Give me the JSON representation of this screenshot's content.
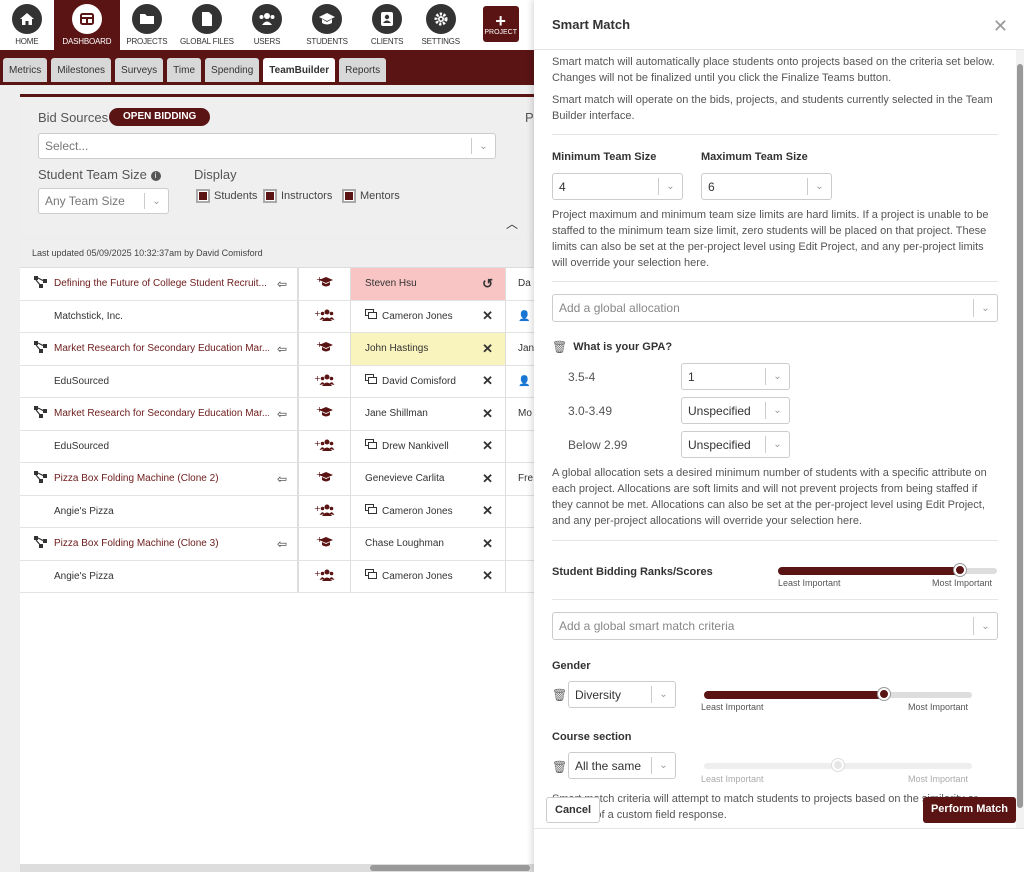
{
  "nav": [
    {
      "label": "HOME",
      "icon": "home-icon"
    },
    {
      "label": "DASHBOARD",
      "icon": "dashboard-icon",
      "active": true
    },
    {
      "label": "PROJECTS",
      "icon": "folder-icon"
    },
    {
      "label": "GLOBAL FILES",
      "icon": "file-icon"
    },
    {
      "label": "USERS",
      "icon": "users-icon"
    },
    {
      "label": "STUDENTS",
      "icon": "graduation-cap-icon"
    },
    {
      "label": "CLIENTS",
      "icon": "client-icon"
    },
    {
      "label": "SETTINGS",
      "icon": "gear-icon"
    },
    {
      "label": "PROJECT",
      "icon": "plus-icon"
    }
  ],
  "tabs": [
    "Metrics",
    "Milestones",
    "Surveys",
    "Time",
    "Spending",
    "TeamBuilder",
    "Reports"
  ],
  "active_tab": "TeamBuilder",
  "filters": {
    "bid_sources_label": "Bid Sources",
    "open_bidding": "OPEN BIDDING",
    "select_placeholder": "Select...",
    "team_size_label": "Student Team Size",
    "team_size_value": "Any Team Size",
    "display_label": "Display",
    "display_options": [
      "Students",
      "Instructors",
      "Mentors"
    ],
    "right_label": "P"
  },
  "table": {
    "updated": "Last updated 05/09/2025 10:32:37am by David Comisford",
    "rows": [
      {
        "type": "project",
        "text": "Defining the Future of College Student Recruit...",
        "student": "Steven Hsu",
        "student_action": "↺",
        "highlight": "pink",
        "extra": "Da"
      },
      {
        "type": "client",
        "text": "Matchstick, Inc.",
        "student": "Cameron Jones",
        "student_icon": true,
        "student_action": "✕",
        "extra": "👤"
      },
      {
        "type": "project",
        "text": "Market Research for Secondary Education Mar...",
        "student": "John Hastings",
        "student_action": "✕",
        "highlight": "yellow",
        "extra": "Jan"
      },
      {
        "type": "client",
        "text": "EduSourced",
        "student": "David Comisford",
        "student_icon": true,
        "student_action": "✕",
        "extra": "👤"
      },
      {
        "type": "project",
        "text": "Market Research for Secondary Education Mar...",
        "student": "Jane Shillman",
        "student_action": "✕",
        "extra": "Mo"
      },
      {
        "type": "client",
        "text": "EduSourced",
        "student": "Drew Nankivell",
        "student_icon": true,
        "student_action": "✕",
        "extra": ""
      },
      {
        "type": "project",
        "text": "Pizza Box Folding Machine (Clone 2)",
        "student": "Genevieve Carlita",
        "student_action": "✕",
        "extra": "Fre"
      },
      {
        "type": "client",
        "text": "Angie's Pizza",
        "student": "Cameron Jones",
        "student_icon": true,
        "student_action": "✕",
        "extra": ""
      },
      {
        "type": "project",
        "text": "Pizza Box Folding Machine (Clone 3)",
        "student": "Chase Loughman",
        "student_action": "✕",
        "extra": ""
      },
      {
        "type": "client",
        "text": "Angie's Pizza",
        "student": "Cameron Jones",
        "student_icon": true,
        "student_action": "✕",
        "extra": ""
      }
    ]
  },
  "panel": {
    "title": "Smart Match",
    "intro1": "Smart match will automatically place students onto projects based on the criteria set below. Changes will not be finalized until you click the Finalize Teams button.",
    "intro2": "Smart match will operate on the bids, projects, and students currently selected in the Team Builder interface.",
    "min_label": "Minimum Team Size",
    "min_value": "4",
    "max_label": "Maximum Team Size",
    "max_value": "6",
    "size_note": "Project maximum and minimum team size limits are hard limits. If a project is unable to be staffed to the minimum team size limit, zero students will be placed on that project. These limits can also be set at the per-project level using Edit Project, and any per-project limits will override your selection here.",
    "allocation_placeholder": "Add a global allocation",
    "gpa_title": "What is your GPA?",
    "gpa_rows": [
      {
        "label": "3.5-4",
        "value": "1"
      },
      {
        "label": "3.0-3.49",
        "value": "Unspecified"
      },
      {
        "label": "Below 2.99",
        "value": "Unspecified"
      }
    ],
    "alloc_note": "A global allocation sets a desired minimum number of students with a specific attribute on each project. Allocations are soft limits and will not prevent projects from being staffed if they cannot be met. Allocations can also be set at the per-project level using Edit Project, and any per-project allocations will override your selection here.",
    "bidding_label": "Student Bidding Ranks/Scores",
    "bidding_level": 0.83,
    "least": "Least Important",
    "most": "Most Important",
    "criteria_placeholder": "Add a global smart match criteria",
    "gender_label": "Gender",
    "gender_value": "Diversity",
    "gender_level": 0.67,
    "course_label": "Course section",
    "course_value": "All the same",
    "course_level": 0.5,
    "criteria_note": "Smart match criteria will attempt to match students to projects based on the similarity or diversity of a custom field response.",
    "cancel": "Cancel",
    "perform": "Perform Match"
  },
  "colors": {
    "accent": "#5a1414",
    "pink": "#f8c4c4",
    "yellow": "#f9f4be"
  }
}
